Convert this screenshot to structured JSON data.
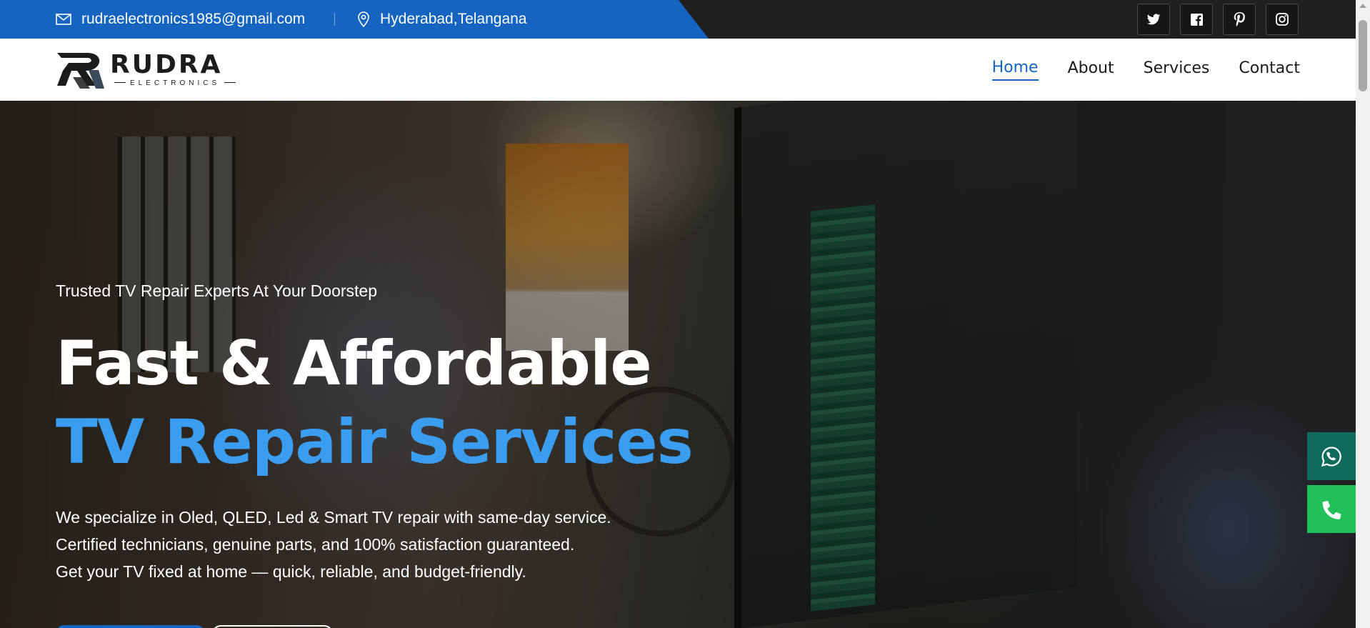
{
  "topbar": {
    "email": "rudraelectronics1985@gmail.com",
    "location": "Hyderabad,Telangana",
    "socials": [
      "twitter-icon",
      "facebook-icon",
      "pinterest-icon",
      "instagram-icon"
    ]
  },
  "logo": {
    "main": "RUDRA",
    "sub": "ELECTRONICS"
  },
  "nav": {
    "items": [
      "Home",
      "About",
      "Services",
      "Contact"
    ],
    "active": "Home"
  },
  "hero": {
    "tagline": "Trusted TV Repair Experts At Your Doorstep",
    "title_line1": "Fast & Affordable",
    "title_line2": "TV Repair Services",
    "description": [
      "We specialize in Oled, QLED, Led & Smart TV repair with same-day service.",
      "Certified technicians, genuine parts, and 100% satisfaction guaranteed.",
      "Get your TV fixed at home — quick, reliable, and budget-friendly."
    ]
  },
  "floating": {
    "whatsapp": "whatsapp-icon",
    "call": "phone-icon"
  },
  "colors": {
    "brand_blue": "#1565c0",
    "accent_blue": "#3a9df0",
    "whatsapp": "#0f6b5a",
    "call": "#22c05a"
  }
}
